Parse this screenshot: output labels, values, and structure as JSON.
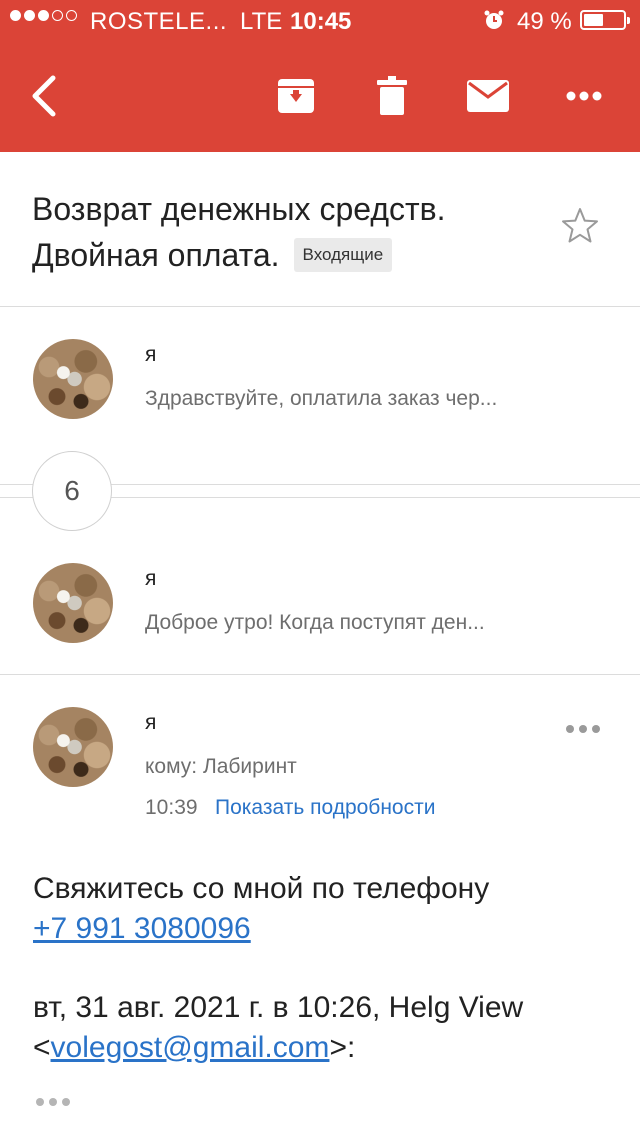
{
  "status_bar": {
    "carrier": "ROSTELE...",
    "network": "LTE",
    "time": "10:45",
    "battery": "49 %",
    "battery_level": 0.49,
    "signal_bars_filled": 3,
    "signal_bars_total": 5
  },
  "toolbar": {
    "color": "#db4437",
    "icons": [
      "back-icon",
      "archive-icon",
      "trash-icon",
      "mail-icon",
      "more-icon"
    ]
  },
  "thread": {
    "subject_line1": "Возврат денежных средств.",
    "subject_line2": "Двойная оплата.",
    "label": "Входящие"
  },
  "messages": [
    {
      "sender": "я",
      "snippet": "Здравствуйте, оплатила заказ чер..."
    },
    {
      "sender": "я",
      "snippet": "Доброе утро! Когда поступят ден..."
    }
  ],
  "collapsed_count": "6",
  "open_message": {
    "sender": "я",
    "to": "кому: Лабиринт",
    "time": "10:39",
    "details_link": "Показать подробности",
    "body_line1": "Свяжитесь со мной по телефону",
    "phone": "+7 991 3080096",
    "quote_header": "вт, 31 авг. 2021 г. в 10:26, Helg View",
    "quote_email_prefix": "<",
    "quote_email": "volegost@gmail.com",
    "quote_email_suffix": ">:"
  }
}
